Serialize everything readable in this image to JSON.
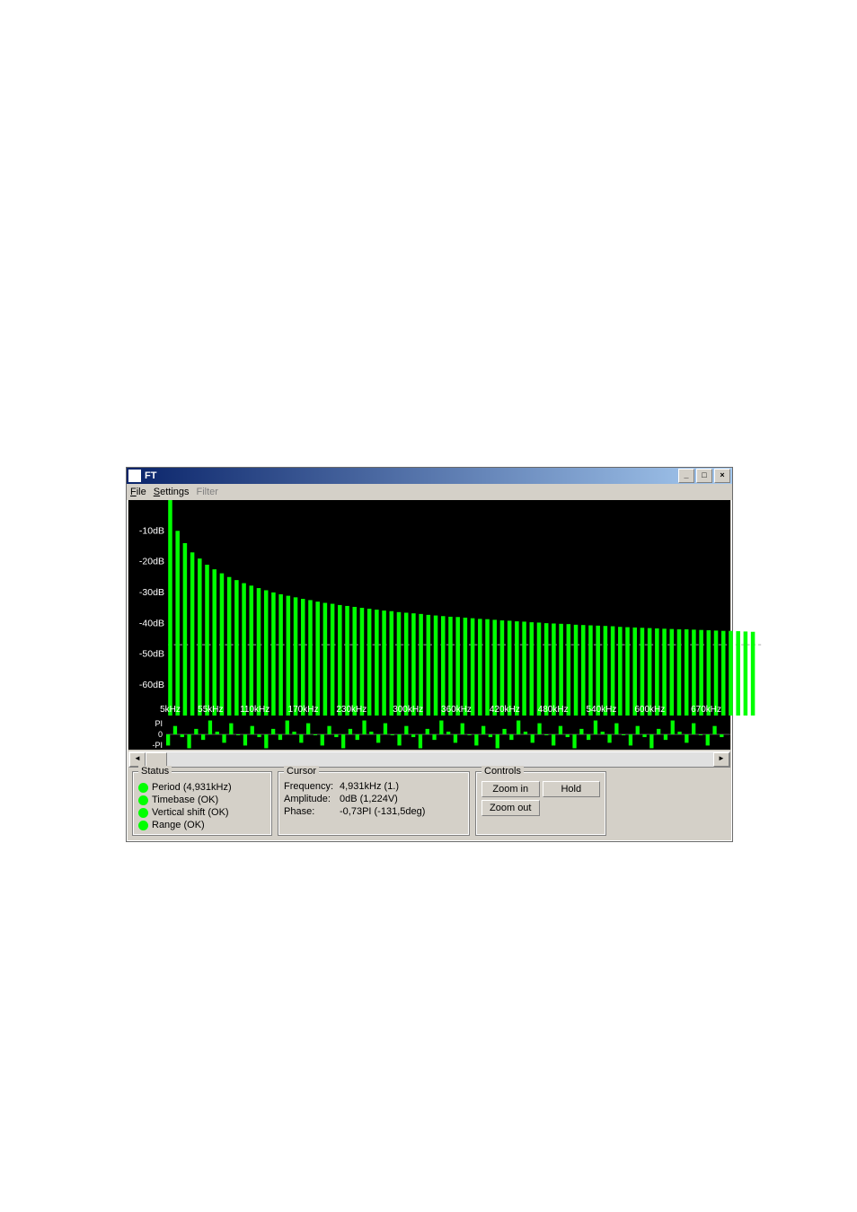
{
  "window": {
    "title": "FT"
  },
  "menu": {
    "file": "File",
    "settings": "Settings",
    "filter": "Filter"
  },
  "chart_data": {
    "type": "bar",
    "title": "",
    "magnitude": {
      "ylabel": "dB",
      "ylim": [
        -70,
        0
      ],
      "yticks": [
        -10,
        -20,
        -30,
        -40,
        -50,
        -60
      ],
      "ytick_labels": [
        "-10dB",
        "-20dB",
        "-30dB",
        "-40dB",
        "-50dB",
        "-60dB"
      ],
      "xticks": [
        5,
        55,
        110,
        170,
        230,
        300,
        360,
        420,
        480,
        540,
        600,
        670
      ],
      "xtick_labels": [
        "5kHz",
        "55kHz",
        "110kHz",
        "170kHz",
        "230kHz",
        "300kHz",
        "360kHz",
        "420kHz",
        "480kHz",
        "540kHz",
        "600kHz",
        "670kHz"
      ],
      "cursor_line_db": -47,
      "values_db": [
        0,
        -10,
        -14,
        -17,
        -19,
        -21,
        -22.5,
        -23.8,
        -25,
        -26,
        -27,
        -27.8,
        -28.6,
        -29.3,
        -30,
        -30.6,
        -31.1,
        -31.6,
        -32.1,
        -32.5,
        -33,
        -33.4,
        -33.7,
        -34.1,
        -34.4,
        -34.7,
        -35,
        -35.3,
        -35.6,
        -35.9,
        -36.1,
        -36.4,
        -36.6,
        -36.8,
        -37,
        -37.3,
        -37.5,
        -37.7,
        -37.9,
        -38,
        -38.2,
        -38.4,
        -38.6,
        -38.7,
        -38.9,
        -39.1,
        -39.2,
        -39.4,
        -39.5,
        -39.7,
        -39.8,
        -40,
        -40.1,
        -40.2,
        -40.3,
        -40.5,
        -40.6,
        -40.7,
        -40.8,
        -40.9,
        -41,
        -41.2,
        -41.3,
        -41.4,
        -41.5,
        -41.6,
        -41.7,
        -41.8,
        -41.9,
        -42,
        -42,
        -42.1,
        -42.2,
        -42.3,
        -42.4,
        -42.5,
        -42.5,
        -42.6,
        -42.7,
        -42.8
      ]
    },
    "phase": {
      "ylim": [
        -3.1416,
        3.1416
      ],
      "yticks": [
        3.1416,
        0,
        -3.1416
      ],
      "ytick_labels": [
        "PI",
        "0",
        "-PI"
      ],
      "values_pi": [
        -0.73,
        0.55,
        -0.18,
        -0.91,
        0.36,
        -0.36,
        0.91,
        0.18,
        -0.55,
        0.73,
        0.0,
        -0.73,
        0.55,
        -0.18,
        -0.91,
        0.36,
        -0.36,
        0.91,
        0.18,
        -0.55,
        0.73,
        0.0,
        -0.73,
        0.55,
        -0.18,
        -0.91,
        0.36,
        -0.36,
        0.91,
        0.18,
        -0.55,
        0.73,
        0.0,
        -0.73,
        0.55,
        -0.18,
        -0.91,
        0.36,
        -0.36,
        0.91,
        0.18,
        -0.55,
        0.73,
        0.0,
        -0.73,
        0.55,
        -0.18,
        -0.91,
        0.36,
        -0.36,
        0.91,
        0.18,
        -0.55,
        0.73,
        0.0,
        -0.73,
        0.55,
        -0.18,
        -0.91,
        0.36,
        -0.36,
        0.91,
        0.18,
        -0.55,
        0.73,
        0.0,
        -0.73,
        0.55,
        -0.18,
        -0.91,
        0.36,
        -0.36,
        0.91,
        0.18,
        -0.55,
        0.73,
        0.0,
        -0.73,
        0.55,
        -0.18
      ]
    }
  },
  "status": {
    "legend": "Status",
    "items": [
      "Period (4,931kHz)",
      "Timebase (OK)",
      "Vertical shift (OK)",
      "Range (OK)"
    ]
  },
  "cursor": {
    "legend": "Cursor",
    "frequency_label": "Frequency:",
    "frequency_value": "4,931kHz (1.)",
    "amplitude_label": "Amplitude:",
    "amplitude_value": "0dB (1,224V)",
    "phase_label": "Phase:",
    "phase_value": "-0,73PI (-131,5deg)"
  },
  "controls": {
    "legend": "Controls",
    "zoom_in": "Zoom in",
    "hold": "Hold",
    "zoom_out": "Zoom out"
  }
}
